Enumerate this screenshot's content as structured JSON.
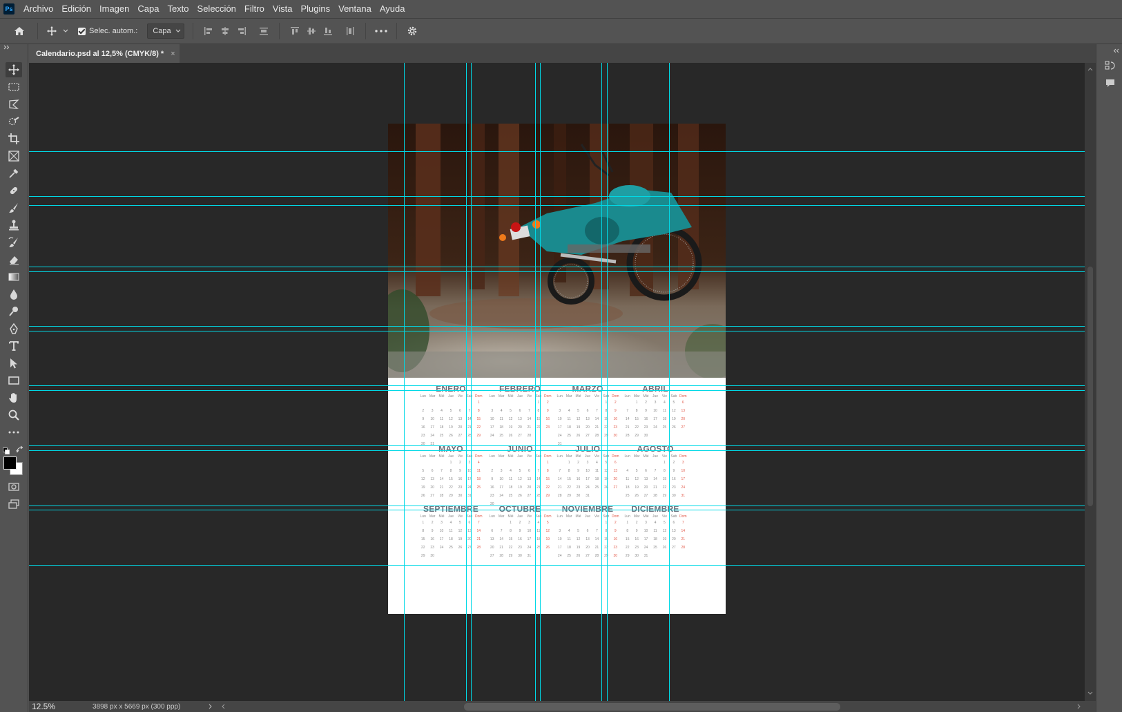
{
  "app": {
    "logo": "Ps",
    "menu": [
      "Archivo",
      "Edición",
      "Imagen",
      "Capa",
      "Texto",
      "Selección",
      "Filtro",
      "Vista",
      "Plugins",
      "Ventana",
      "Ayuda"
    ]
  },
  "options_bar": {
    "auto_select_label": "Selec. autom.:",
    "auto_select_checked": true,
    "layer_select_value": "Capa"
  },
  "document_tab": {
    "title": "Calendario.psd al 12,5% (CMYK/8) *",
    "close_glyph": "×"
  },
  "status_bar": {
    "zoom": "12.5%",
    "doc_info": "3898 px x 5669 px (300 ppp)"
  },
  "calendar": {
    "weekdays": [
      "Lun",
      "Mar",
      "Mié",
      "Jue",
      "Vie",
      "Sab",
      "Dom"
    ],
    "months": [
      {
        "name": "ENERO",
        "days": [
          "",
          "",
          "",
          "",
          "",
          "",
          "1",
          "2",
          "3",
          "4",
          "5",
          "6",
          "7",
          "8",
          "9",
          "10",
          "11",
          "12",
          "13",
          "14",
          "15",
          "16",
          "17",
          "18",
          "19",
          "20",
          "21",
          "22",
          "23",
          "24",
          "25",
          "26",
          "27",
          "28",
          "29",
          "30",
          "31"
        ]
      },
      {
        "name": "FEBRERO",
        "days": [
          "",
          "",
          "",
          "",
          "",
          "1",
          "2",
          "3",
          "4",
          "5",
          "6",
          "7",
          "8",
          "9",
          "10",
          "11",
          "12",
          "13",
          "14",
          "15",
          "16",
          "17",
          "18",
          "19",
          "20",
          "21",
          "22",
          "23",
          "24",
          "25",
          "26",
          "27",
          "28"
        ]
      },
      {
        "name": "MARZO",
        "days": [
          "",
          "",
          "",
          "",
          "",
          "1",
          "2",
          "3",
          "4",
          "5",
          "6",
          "7",
          "8",
          "9",
          "10",
          "11",
          "12",
          "13",
          "14",
          "15",
          "16",
          "17",
          "18",
          "19",
          "20",
          "21",
          "22",
          "23",
          "24",
          "25",
          "26",
          "27",
          "28",
          "29",
          "30",
          "31"
        ]
      },
      {
        "name": "ABRIL",
        "days": [
          "",
          "1",
          "2",
          "3",
          "4",
          "5",
          "6",
          "7",
          "8",
          "9",
          "10",
          "11",
          "12",
          "13",
          "14",
          "15",
          "16",
          "17",
          "18",
          "19",
          "20",
          "21",
          "22",
          "23",
          "24",
          "25",
          "26",
          "27",
          "28",
          "29",
          "30"
        ]
      },
      {
        "name": "MAYO",
        "days": [
          "",
          "",
          "",
          "1",
          "2",
          "3",
          "4",
          "5",
          "6",
          "7",
          "8",
          "9",
          "10",
          "11",
          "12",
          "13",
          "14",
          "15",
          "16",
          "17",
          "18",
          "19",
          "20",
          "21",
          "22",
          "23",
          "24",
          "25",
          "26",
          "27",
          "28",
          "29",
          "30",
          "31"
        ]
      },
      {
        "name": "JUNIO",
        "days": [
          "",
          "",
          "",
          "",
          "",
          "",
          "1",
          "2",
          "3",
          "4",
          "5",
          "6",
          "7",
          "8",
          "9",
          "10",
          "11",
          "12",
          "13",
          "14",
          "15",
          "16",
          "17",
          "18",
          "19",
          "20",
          "21",
          "22",
          "23",
          "24",
          "25",
          "26",
          "27",
          "28",
          "29",
          "30"
        ]
      },
      {
        "name": "JULIO",
        "days": [
          "",
          "1",
          "2",
          "3",
          "4",
          "5",
          "6",
          "7",
          "8",
          "9",
          "10",
          "11",
          "12",
          "13",
          "14",
          "15",
          "16",
          "17",
          "18",
          "19",
          "20",
          "21",
          "22",
          "23",
          "24",
          "25",
          "26",
          "27",
          "28",
          "29",
          "30",
          "31"
        ]
      },
      {
        "name": "AGOSTO",
        "days": [
          "",
          "",
          "",
          "",
          "1",
          "2",
          "3",
          "4",
          "5",
          "6",
          "7",
          "8",
          "9",
          "10",
          "11",
          "12",
          "13",
          "14",
          "15",
          "16",
          "17",
          "18",
          "19",
          "20",
          "21",
          "22",
          "23",
          "24",
          "25",
          "26",
          "27",
          "28",
          "29",
          "30",
          "31"
        ]
      },
      {
        "name": "SEPTIEMBRE",
        "days": [
          "1",
          "2",
          "3",
          "4",
          "5",
          "6",
          "7",
          "8",
          "9",
          "10",
          "11",
          "12",
          "13",
          "14",
          "15",
          "16",
          "17",
          "18",
          "19",
          "20",
          "21",
          "22",
          "23",
          "24",
          "25",
          "26",
          "27",
          "28",
          "29",
          "30"
        ]
      },
      {
        "name": "OCTUBRE",
        "days": [
          "",
          "",
          "1",
          "2",
          "3",
          "4",
          "5",
          "6",
          "7",
          "8",
          "9",
          "10",
          "11",
          "12",
          "13",
          "14",
          "15",
          "16",
          "17",
          "18",
          "19",
          "20",
          "21",
          "22",
          "23",
          "24",
          "25",
          "26",
          "27",
          "28",
          "29",
          "30",
          "31"
        ]
      },
      {
        "name": "NOVIEMBRE",
        "days": [
          "",
          "",
          "",
          "",
          "",
          "1",
          "2",
          "3",
          "4",
          "5",
          "6",
          "7",
          "8",
          "9",
          "10",
          "11",
          "12",
          "13",
          "14",
          "15",
          "16",
          "17",
          "18",
          "19",
          "20",
          "21",
          "22",
          "23",
          "24",
          "25",
          "26",
          "27",
          "28",
          "29",
          "30"
        ]
      },
      {
        "name": "DICIEMBRE",
        "days": [
          "1",
          "2",
          "3",
          "4",
          "5",
          "6",
          "7",
          "8",
          "9",
          "10",
          "11",
          "12",
          "13",
          "14",
          "15",
          "16",
          "17",
          "18",
          "19",
          "20",
          "21",
          "22",
          "23",
          "24",
          "25",
          "26",
          "27",
          "28",
          "29",
          "30",
          "31"
        ]
      }
    ]
  },
  "colors": {
    "guide": "#00d9e6",
    "sunday": "#e35a4a",
    "month_title": "#6a6f7a"
  },
  "tools": [
    "move-tool",
    "marquee-tool",
    "lasso-tool",
    "quick-select-tool",
    "crop-tool",
    "frame-tool",
    "eyedropper-tool",
    "healing-brush-tool",
    "brush-tool",
    "stamp-tool",
    "history-brush-tool",
    "eraser-tool",
    "gradient-tool",
    "blur-tool",
    "dodge-tool",
    "pen-tool",
    "type-tool",
    "path-select-tool",
    "rectangle-tool",
    "hand-tool",
    "zoom-tool",
    "more-tools"
  ]
}
